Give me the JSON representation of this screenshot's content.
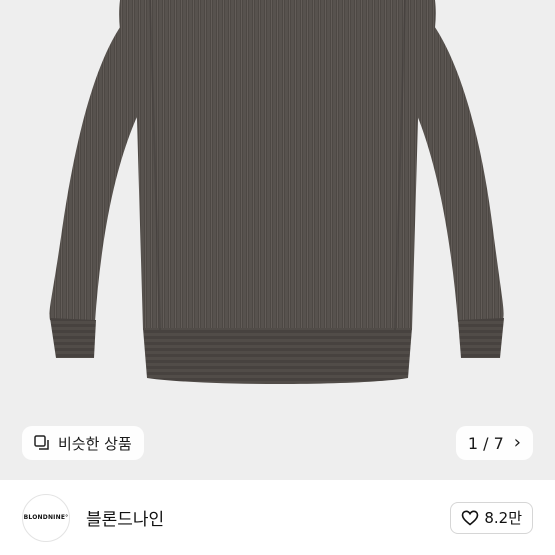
{
  "product": {
    "image_icon": "knit-sweater-photo",
    "similar_label": "비슷한 상품",
    "similar_icon": "similar-items-icon",
    "pager_text": "1 / 7",
    "pager_next_icon": "chevron-right-icon"
  },
  "shop": {
    "logo_text": "BLONDNINE°",
    "name": "블론드나인",
    "like_icon": "heart-icon",
    "like_count": "8.2만"
  },
  "colors": {
    "sweater": "#55504c",
    "background": "#eeeeee"
  }
}
